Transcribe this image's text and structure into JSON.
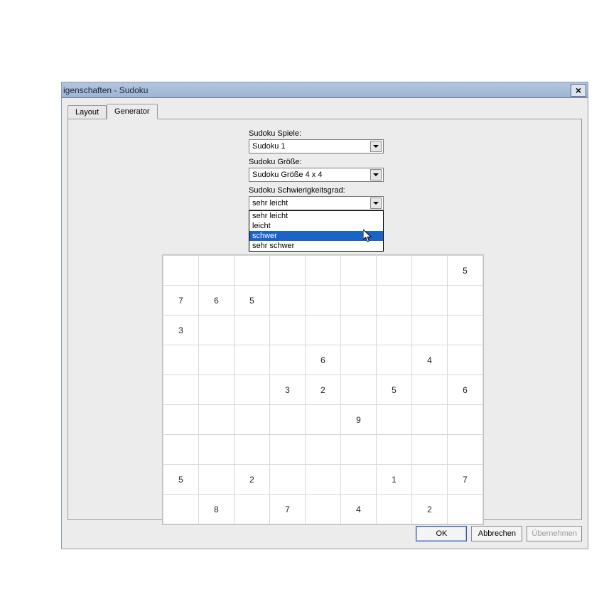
{
  "titlebar": {
    "title": "igenschaften - Sudoku",
    "close": "×"
  },
  "tabs": [
    {
      "id": "layout",
      "label": "Layout",
      "active": false
    },
    {
      "id": "generator",
      "label": "Generator",
      "active": true
    }
  ],
  "fields": {
    "spiele": {
      "label": "Sudoku Spiele:",
      "value": "Sudoku 1"
    },
    "groesse": {
      "label": "Sudoku Größe:",
      "value": "Sudoku Größe 4 x 4"
    },
    "schwierigkeit": {
      "label": "Sudoku Schwierigkeitsgrad:",
      "value": "sehr leicht",
      "options": [
        "sehr leicht",
        "leicht",
        "schwer",
        "sehr schwer"
      ],
      "highlight_index": 2
    }
  },
  "grid": [
    [
      "",
      "",
      "",
      "",
      "",
      "",
      "",
      "",
      "5"
    ],
    [
      "7",
      "6",
      "5",
      "",
      "",
      "",
      "",
      "",
      ""
    ],
    [
      "3",
      "",
      "",
      "",
      "",
      "",
      "",
      "",
      ""
    ],
    [
      "",
      "",
      "",
      "",
      "6",
      "",
      "",
      "4",
      ""
    ],
    [
      "",
      "",
      "",
      "3",
      "2",
      "",
      "5",
      "",
      "6"
    ],
    [
      "",
      "",
      "",
      "",
      "",
      "9",
      "",
      "",
      ""
    ],
    [
      "",
      "",
      "",
      "",
      "",
      "",
      "",
      "",
      ""
    ],
    [
      "5",
      "",
      "2",
      "",
      "",
      "",
      "1",
      "",
      "7"
    ],
    [
      "",
      "8",
      "",
      "7",
      "",
      "4",
      "",
      "2",
      ""
    ]
  ],
  "buttons": {
    "ok": "OK",
    "cancel": "Abbrechen",
    "apply": "Übernehmen"
  }
}
